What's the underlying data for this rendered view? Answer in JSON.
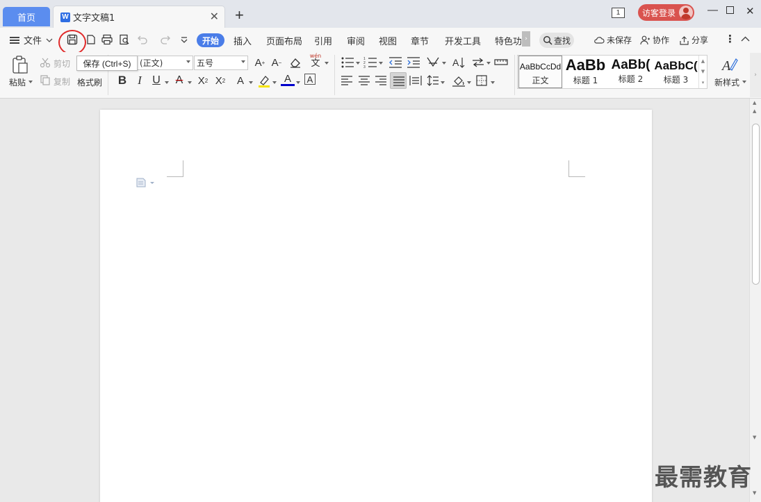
{
  "tabs": {
    "home_label": "首页",
    "document_label": "文字文稿1",
    "doc_badge": "W"
  },
  "window": {
    "page_count": "1",
    "login_label": "访客登录"
  },
  "menu": {
    "file_label": "文件",
    "items": [
      "开始",
      "插入",
      "页面布局",
      "引用",
      "审阅",
      "视图",
      "章节",
      "开发工具",
      "特色功"
    ],
    "active_index": 0,
    "search_label": "查找",
    "unsaved_label": "未保存",
    "collab_label": "协作",
    "share_label": "分享"
  },
  "tooltip": {
    "text": "保存 (Ctrl+S)"
  },
  "ribbon": {
    "paste_label": "粘贴",
    "cut_label": "剪切",
    "copy_label": "复制",
    "format_painter_label": "格式刷",
    "font_name": "(正文)",
    "font_size": "五号",
    "phonetic_label": "wén",
    "phonetic_char": "文",
    "new_style_label": "新样式"
  },
  "styles": [
    {
      "sample": "AaBbCcDd",
      "name": "正文"
    },
    {
      "sample": "AaBb",
      "name": "标题 1"
    },
    {
      "sample": "AaBb(",
      "name": "标题 2"
    },
    {
      "sample": "AaBbC(",
      "name": "标题 3"
    }
  ],
  "watermark": {
    "text": "最需教育"
  },
  "colors": {
    "accent": "#4a7de8",
    "home_tab": "#5b8def",
    "login": "#d9534f",
    "highlight_marker": "#e02a2a",
    "highlight_yellow": "#f5e400",
    "font_color_red": "#d80000",
    "font_color_blue": "#0000cc"
  }
}
